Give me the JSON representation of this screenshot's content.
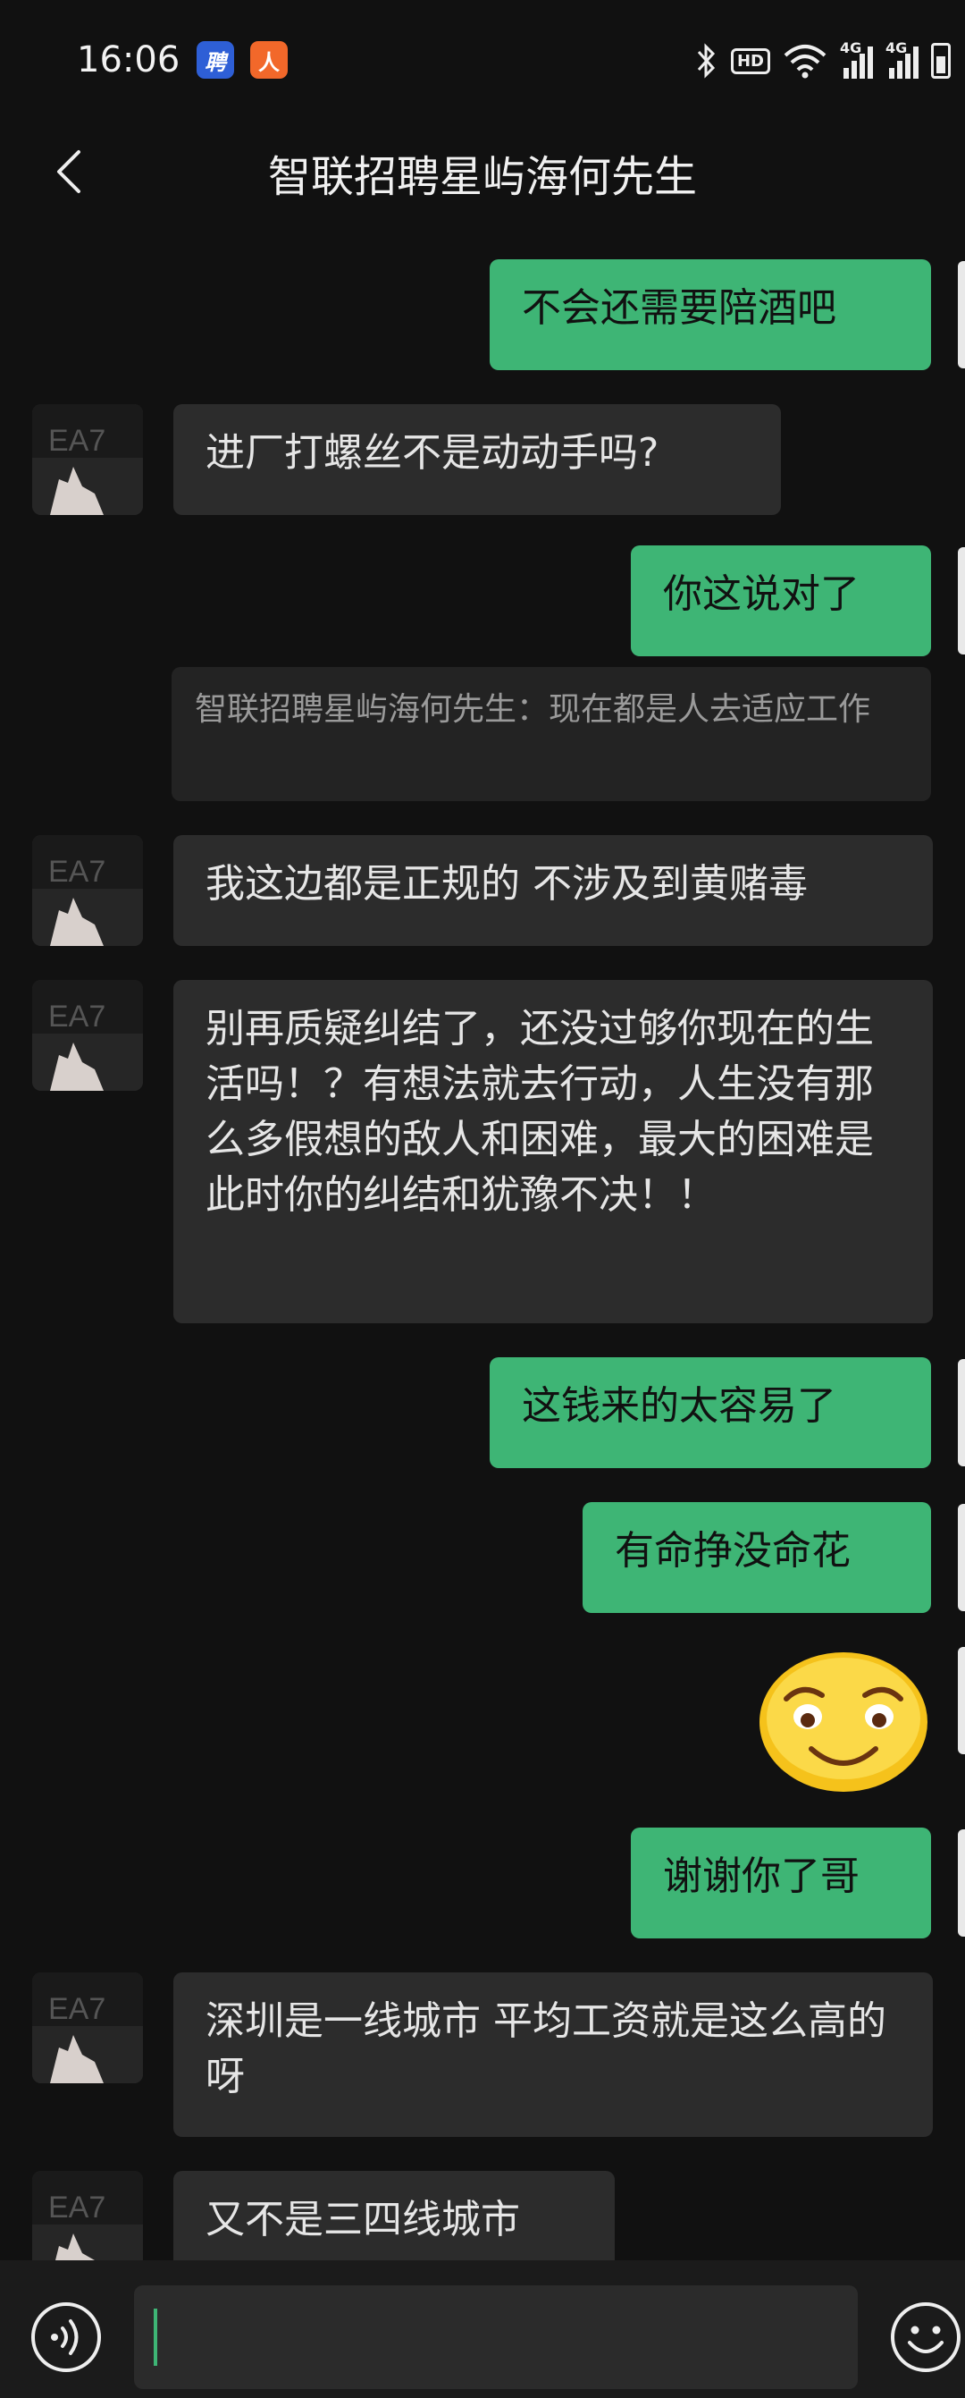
{
  "status": {
    "time": "16:06",
    "app1": "聘",
    "app2": "人",
    "hd": "HD",
    "net1": "4G",
    "net2": "4G"
  },
  "header": {
    "title": "智联招聘星屿海何先生"
  },
  "messages": {
    "m1": "不会还需要陪酒吧",
    "m2": "进厂打螺丝不是动动手吗?",
    "m3": "你这说对了",
    "q1": "智联招聘星屿海何先生：现在都是人去适应工作",
    "m4": "我这边都是正规的 不涉及到黄赌毒",
    "m5": "别再质疑纠结了，还没过够你现在的生活吗！？有想法就去行动，人生没有那么多假想的敌人和困难，最大的困难是此时你的纠结和犹豫不决！！",
    "m6": "这钱来的太容易了",
    "m7": "有命挣没命花",
    "m8": "谢谢你了哥",
    "m9": "深圳是一线城市 平均工资就是这么高的呀",
    "m10": "又不是三四线城市"
  },
  "colors": {
    "outgoing": "#3eb575",
    "incoming": "#2c2c2c",
    "background": "#111111"
  },
  "icons": [
    "back-icon",
    "voice-icon",
    "emoji-icon",
    "smiley-sticker",
    "bluetooth-icon",
    "wifi-icon"
  ]
}
